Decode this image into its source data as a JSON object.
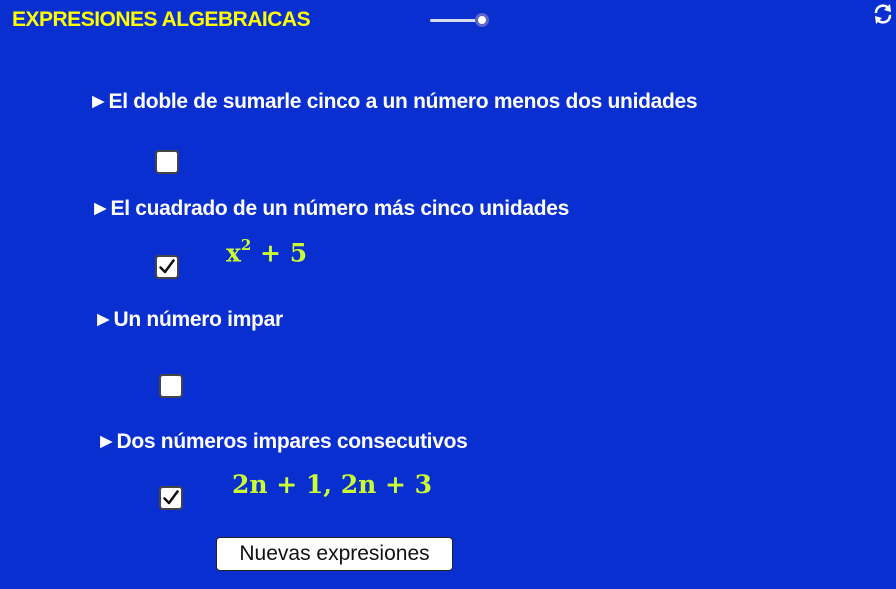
{
  "colors": {
    "background": "#0a2fd0",
    "title": "#ffff00",
    "statement": "#ffffff",
    "expression": "#ccff33"
  },
  "header": {
    "title": "EXPRESIONES ALGEBRAICAS",
    "slider_icon": "slider-control",
    "refresh_icon": "refresh-icon"
  },
  "items": [
    {
      "statement": "►El doble de sumarle cinco a un número menos dos unidades",
      "checked": false,
      "expression": ""
    },
    {
      "statement": "►El cuadrado de un número más cinco unidades",
      "checked": true,
      "expression_base": "x",
      "expression_sup": "2",
      "expression_rest": " + 5"
    },
    {
      "statement": "►Un número impar",
      "checked": false,
      "expression": ""
    },
    {
      "statement": "►Dos números impares consecutivos",
      "checked": true,
      "expression": "2n + 1, 2n + 3"
    }
  ],
  "button": {
    "label": "Nuevas expresiones"
  }
}
